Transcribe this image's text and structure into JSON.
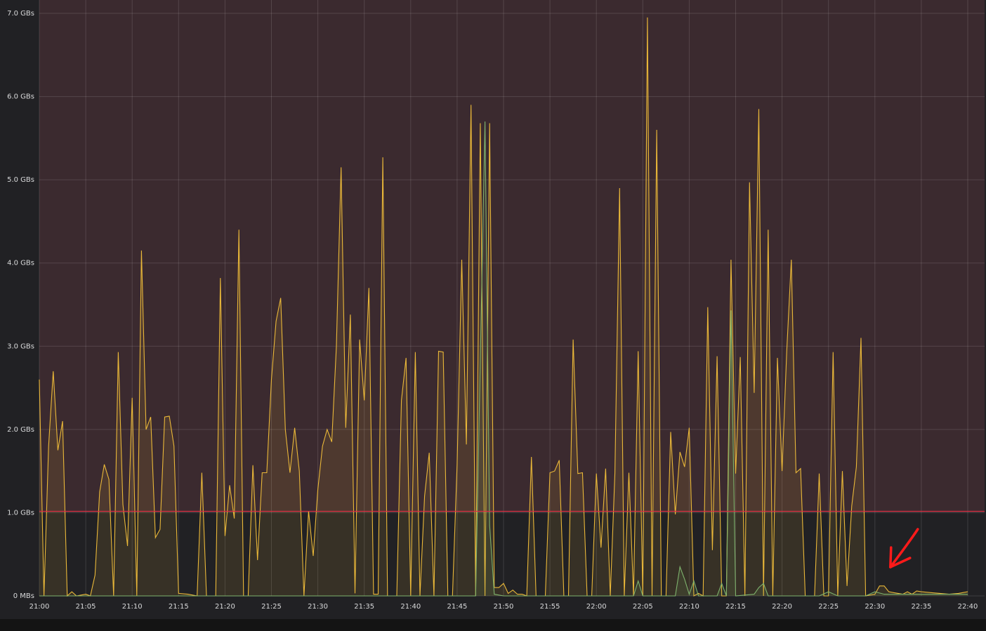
{
  "chart_data": {
    "type": "area",
    "title": "",
    "xlabel": "",
    "ylabel": "",
    "x_ticks": [
      "21:00",
      "21:05",
      "21:10",
      "21:15",
      "21:20",
      "21:25",
      "21:30",
      "21:35",
      "21:40",
      "21:45",
      "21:50",
      "21:55",
      "22:00",
      "22:05",
      "22:10",
      "22:15",
      "22:20",
      "22:25",
      "22:30",
      "22:35",
      "22:40"
    ],
    "y_ticks": [
      {
        "value": 0,
        "label": "0 MBs"
      },
      {
        "value": 1,
        "label": "1.0 GBs"
      },
      {
        "value": 2,
        "label": "2.0 GBs"
      },
      {
        "value": 3,
        "label": "3.0 GBs"
      },
      {
        "value": 4,
        "label": "4.0 GBs"
      },
      {
        "value": 5,
        "label": "5.0 GBs"
      },
      {
        "value": 6,
        "label": "6.0 GBs"
      },
      {
        "value": 7,
        "label": "7.0 GBs"
      }
    ],
    "ylim": [
      0,
      7
    ],
    "xlim": [
      "21:00",
      "22:40"
    ],
    "threshold": {
      "value": 1.0,
      "color": "#e02f44",
      "fill_above": "#3b2a2f"
    },
    "grid": true,
    "annotation": {
      "type": "arrow",
      "color": "#ff1a1a",
      "points_to": "22:30"
    },
    "series": [
      {
        "color": "#eab839",
        "points": [
          [
            "21:00",
            2.6
          ],
          [
            "21:00:30",
            0.0
          ],
          [
            "21:01",
            1.8
          ],
          [
            "21:01:30",
            2.7
          ],
          [
            "21:02",
            1.75
          ],
          [
            "21:02:30",
            2.1
          ],
          [
            "21:03",
            0.0
          ],
          [
            "21:03:30",
            0.05
          ],
          [
            "21:04",
            0.0
          ],
          [
            "21:05",
            0.02
          ],
          [
            "21:05:30",
            0.0
          ],
          [
            "21:06",
            0.25
          ],
          [
            "21:06:30",
            1.25
          ],
          [
            "21:07",
            1.58
          ],
          [
            "21:07:30",
            1.4
          ],
          [
            "21:08",
            0.0
          ],
          [
            "21:08:30",
            2.93
          ],
          [
            "21:09",
            1.1
          ],
          [
            "21:09:30",
            0.6
          ],
          [
            "21:10",
            2.38
          ],
          [
            "21:10:30",
            0.0
          ],
          [
            "21:11",
            4.15
          ],
          [
            "21:11:30",
            2.0
          ],
          [
            "21:12",
            2.15
          ],
          [
            "21:12:30",
            0.7
          ],
          [
            "21:13",
            0.8
          ],
          [
            "21:13:30",
            2.15
          ],
          [
            "21:14",
            2.16
          ],
          [
            "21:14:30",
            1.8
          ],
          [
            "21:15",
            0.03
          ],
          [
            "21:16",
            0.02
          ],
          [
            "21:17",
            0.0
          ],
          [
            "21:17:30",
            1.48
          ],
          [
            "21:18",
            0.0
          ],
          [
            "21:19",
            0.0
          ],
          [
            "21:19:30",
            3.82
          ],
          [
            "21:20",
            0.72
          ],
          [
            "21:20:30",
            1.33
          ],
          [
            "21:21",
            0.93
          ],
          [
            "21:21:30",
            4.4
          ],
          [
            "21:22",
            0.0
          ],
          [
            "21:22:30",
            0.0
          ],
          [
            "21:23",
            1.57
          ],
          [
            "21:23:30",
            0.43
          ],
          [
            "21:24",
            1.48
          ],
          [
            "21:24:30",
            1.48
          ],
          [
            "21:25",
            2.6
          ],
          [
            "21:25:30",
            3.3
          ],
          [
            "21:26",
            3.58
          ],
          [
            "21:26:30",
            2.0
          ],
          [
            "21:27",
            1.48
          ],
          [
            "21:27:30",
            2.02
          ],
          [
            "21:28",
            1.5
          ],
          [
            "21:28:30",
            0.0
          ],
          [
            "21:29",
            1.02
          ],
          [
            "21:29:30",
            0.48
          ],
          [
            "21:30",
            1.28
          ],
          [
            "21:30:30",
            1.8
          ],
          [
            "21:31",
            2.0
          ],
          [
            "21:31:30",
            1.85
          ],
          [
            "21:32",
            3.0
          ],
          [
            "21:32:30",
            5.15
          ],
          [
            "21:33",
            2.02
          ],
          [
            "21:33:30",
            3.38
          ],
          [
            "21:34",
            0.03
          ],
          [
            "21:34:30",
            3.08
          ],
          [
            "21:35",
            2.35
          ],
          [
            "21:35:30",
            3.7
          ],
          [
            "21:36",
            0.02
          ],
          [
            "21:36:30",
            0.02
          ],
          [
            "21:37",
            5.27
          ],
          [
            "21:37:30",
            0.0
          ],
          [
            "21:38",
            0.0
          ],
          [
            "21:38:30",
            0.0
          ],
          [
            "21:39",
            2.35
          ],
          [
            "21:39:30",
            2.86
          ],
          [
            "21:40",
            0.0
          ],
          [
            "21:40:30",
            2.93
          ],
          [
            "21:41",
            0.0
          ],
          [
            "21:41:30",
            1.2
          ],
          [
            "21:42",
            1.72
          ],
          [
            "21:42:30",
            0.0
          ],
          [
            "21:43",
            2.94
          ],
          [
            "21:43:30",
            2.93
          ],
          [
            "21:44",
            0.0
          ],
          [
            "21:44:30",
            0.0
          ],
          [
            "21:45",
            1.58
          ],
          [
            "21:45:30",
            4.04
          ],
          [
            "21:46",
            1.82
          ],
          [
            "21:46:30",
            5.9
          ],
          [
            "21:47",
            0.0
          ],
          [
            "21:47:30",
            5.68
          ],
          [
            "21:48",
            0.0
          ],
          [
            "21:48:30",
            5.68
          ],
          [
            "21:49",
            0.1
          ],
          [
            "21:49:30",
            0.1
          ],
          [
            "21:50",
            0.15
          ],
          [
            "21:50:30",
            0.03
          ],
          [
            "21:51",
            0.07
          ],
          [
            "21:51:30",
            0.02
          ],
          [
            "21:52",
            0.02
          ],
          [
            "21:52:30",
            0.0
          ],
          [
            "21:53",
            1.67
          ],
          [
            "21:53:30",
            0.0
          ],
          [
            "21:54",
            0.0
          ],
          [
            "21:54:30",
            0.0
          ],
          [
            "21:55",
            1.48
          ],
          [
            "21:55:30",
            1.5
          ],
          [
            "21:56",
            1.63
          ],
          [
            "21:56:30",
            0.0
          ],
          [
            "21:57",
            0.0
          ],
          [
            "21:57:30",
            3.08
          ],
          [
            "21:58",
            1.47
          ],
          [
            "21:58:30",
            1.48
          ],
          [
            "21:59",
            0.0
          ],
          [
            "21:59:30",
            0.0
          ],
          [
            "22:00",
            1.47
          ],
          [
            "22:00:30",
            0.58
          ],
          [
            "22:01",
            1.53
          ],
          [
            "22:01:30",
            0.0
          ],
          [
            "22:02",
            1.48
          ],
          [
            "22:02:30",
            4.9
          ],
          [
            "22:03",
            0.0
          ],
          [
            "22:03:30",
            1.48
          ],
          [
            "22:04",
            0.0
          ],
          [
            "22:04:30",
            2.94
          ],
          [
            "22:05",
            0.0
          ],
          [
            "22:05:30",
            6.95
          ],
          [
            "22:06",
            0.0
          ],
          [
            "22:06:30",
            5.6
          ],
          [
            "22:07",
            0.0
          ],
          [
            "22:07:30",
            0.0
          ],
          [
            "22:08",
            1.97
          ],
          [
            "22:08:30",
            0.98
          ],
          [
            "22:09",
            1.73
          ],
          [
            "22:09:30",
            1.55
          ],
          [
            "22:10",
            2.02
          ],
          [
            "22:10:30",
            0.0
          ],
          [
            "22:11",
            0.03
          ],
          [
            "22:11:30",
            0.0
          ],
          [
            "22:12",
            3.47
          ],
          [
            "22:12:30",
            0.55
          ],
          [
            "22:13",
            2.88
          ],
          [
            "22:13:30",
            0.0
          ],
          [
            "22:14",
            0.0
          ],
          [
            "22:14:30",
            4.04
          ],
          [
            "22:15",
            1.47
          ],
          [
            "22:15:30",
            2.87
          ],
          [
            "22:16",
            0.0
          ],
          [
            "22:16:30",
            4.97
          ],
          [
            "22:17",
            2.44
          ],
          [
            "22:17:30",
            5.85
          ],
          [
            "22:18",
            0.0
          ],
          [
            "22:18:30",
            4.4
          ],
          [
            "22:19",
            0.0
          ],
          [
            "22:19:30",
            2.86
          ],
          [
            "22:20",
            1.5
          ],
          [
            "22:20:30",
            2.93
          ],
          [
            "22:21",
            4.04
          ],
          [
            "22:21:30",
            1.48
          ],
          [
            "22:22",
            1.53
          ],
          [
            "22:22:30",
            0.0
          ],
          [
            "22:23",
            0.0
          ],
          [
            "22:23:30",
            0.0
          ],
          [
            "22:24",
            1.47
          ],
          [
            "22:24:30",
            0.0
          ],
          [
            "22:25",
            0.0
          ],
          [
            "22:25:30",
            2.93
          ],
          [
            "22:26",
            0.0
          ],
          [
            "22:26:30",
            1.5
          ],
          [
            "22:27",
            0.12
          ],
          [
            "22:27:30",
            1.08
          ],
          [
            "22:28",
            1.55
          ],
          [
            "22:28:30",
            3.1
          ],
          [
            "22:29",
            0.0
          ],
          [
            "22:30",
            0.02
          ],
          [
            "22:30:30",
            0.12
          ],
          [
            "22:31",
            0.12
          ],
          [
            "22:31:30",
            0.05
          ],
          [
            "22:32",
            0.04
          ],
          [
            "22:33",
            0.02
          ],
          [
            "22:33:30",
            0.05
          ],
          [
            "22:34",
            0.02
          ],
          [
            "22:34:30",
            0.06
          ],
          [
            "22:35",
            0.05
          ],
          [
            "22:36",
            0.04
          ],
          [
            "22:37",
            0.03
          ],
          [
            "22:38",
            0.02
          ],
          [
            "22:39",
            0.03
          ],
          [
            "22:40",
            0.05
          ]
        ]
      },
      {
        "color": "#7eb26d",
        "points": [
          [
            "21:00",
            0.0
          ],
          [
            "21:47",
            0.0
          ],
          [
            "21:48",
            5.7
          ],
          [
            "21:48:30",
            0.85
          ],
          [
            "21:49",
            0.02
          ],
          [
            "21:50",
            0.0
          ],
          [
            "22:00",
            0.0
          ],
          [
            "22:04",
            0.0
          ],
          [
            "22:04:30",
            0.18
          ],
          [
            "22:05",
            0.0
          ],
          [
            "22:08",
            0.0
          ],
          [
            "22:08:30",
            0.0
          ],
          [
            "22:09",
            0.35
          ],
          [
            "22:09:30",
            0.2
          ],
          [
            "22:10",
            0.02
          ],
          [
            "22:10:30",
            0.18
          ],
          [
            "22:11",
            0.0
          ],
          [
            "22:13",
            0.0
          ],
          [
            "22:13:30",
            0.15
          ],
          [
            "22:14",
            0.0
          ],
          [
            "22:14:30",
            3.43
          ],
          [
            "22:15",
            0.0
          ],
          [
            "22:17",
            0.02
          ],
          [
            "22:17:30",
            0.1
          ],
          [
            "22:18",
            0.15
          ],
          [
            "22:18:30",
            0.0
          ],
          [
            "22:24",
            0.0
          ],
          [
            "22:25",
            0.05
          ],
          [
            "22:26",
            0.0
          ],
          [
            "22:29",
            0.0
          ],
          [
            "22:30",
            0.05
          ],
          [
            "22:31",
            0.02
          ],
          [
            "22:40",
            0.02
          ]
        ]
      }
    ]
  }
}
